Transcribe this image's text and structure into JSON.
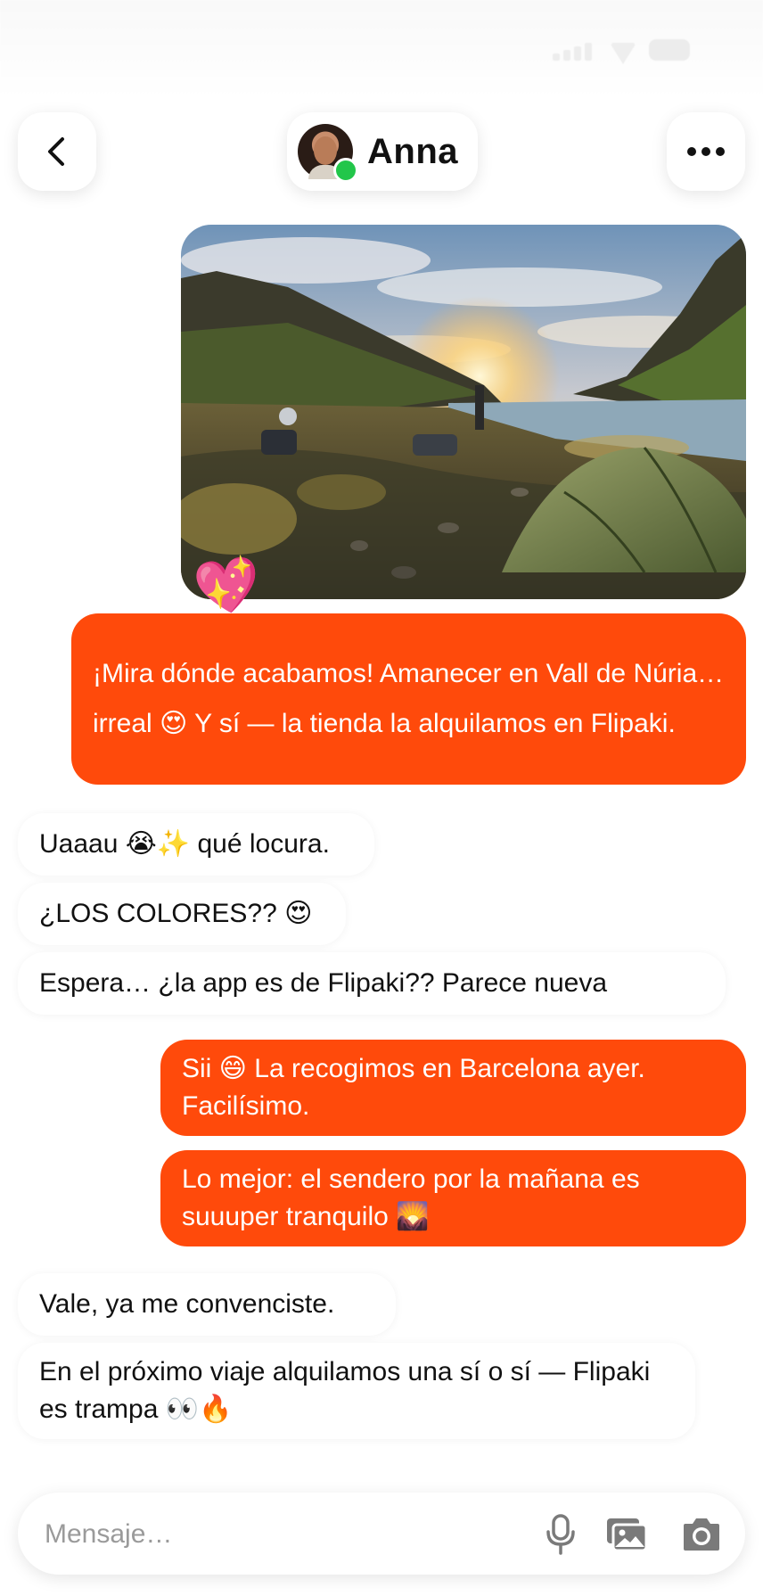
{
  "header": {
    "contact_name": "Anna"
  },
  "icons": {
    "back": "chevron-left-icon",
    "more": "more-horizontal-icon",
    "mic": "microphone-icon",
    "gallery": "gallery-icon",
    "camera": "camera-icon"
  },
  "colors": {
    "outgoing_bubble": "#ff4a0b",
    "online_indicator": "#22c64a"
  },
  "photo_reaction": "💖",
  "messages": [
    {
      "direction": "out",
      "text": "¡Mira dónde acabamos! Amanecer en Vall de Núria… irreal 😍 Y sí — la tienda la alquilamos en Flipaki."
    },
    {
      "direction": "in",
      "text": "Uaaau 😭✨ qué locura."
    },
    {
      "direction": "in",
      "text": "¿LOS COLORES?? 😍"
    },
    {
      "direction": "in",
      "text": "Espera… ¿la app es de Flipaki?? Parece nueva"
    },
    {
      "direction": "out",
      "text": "Sii 😄 La recogimos en Barcelona ayer. Facilísimo."
    },
    {
      "direction": "out",
      "text": "Lo mejor: el sendero por la mañana es suuuper tranquilo 🌄"
    },
    {
      "direction": "in",
      "text": "Vale, ya me convenciste."
    },
    {
      "direction": "in",
      "text": "En el próximo viaje alquilamos una sí o sí — Flipaki es trampa 👀🔥"
    }
  ],
  "composer": {
    "placeholder": "Mensaje…",
    "value": ""
  }
}
